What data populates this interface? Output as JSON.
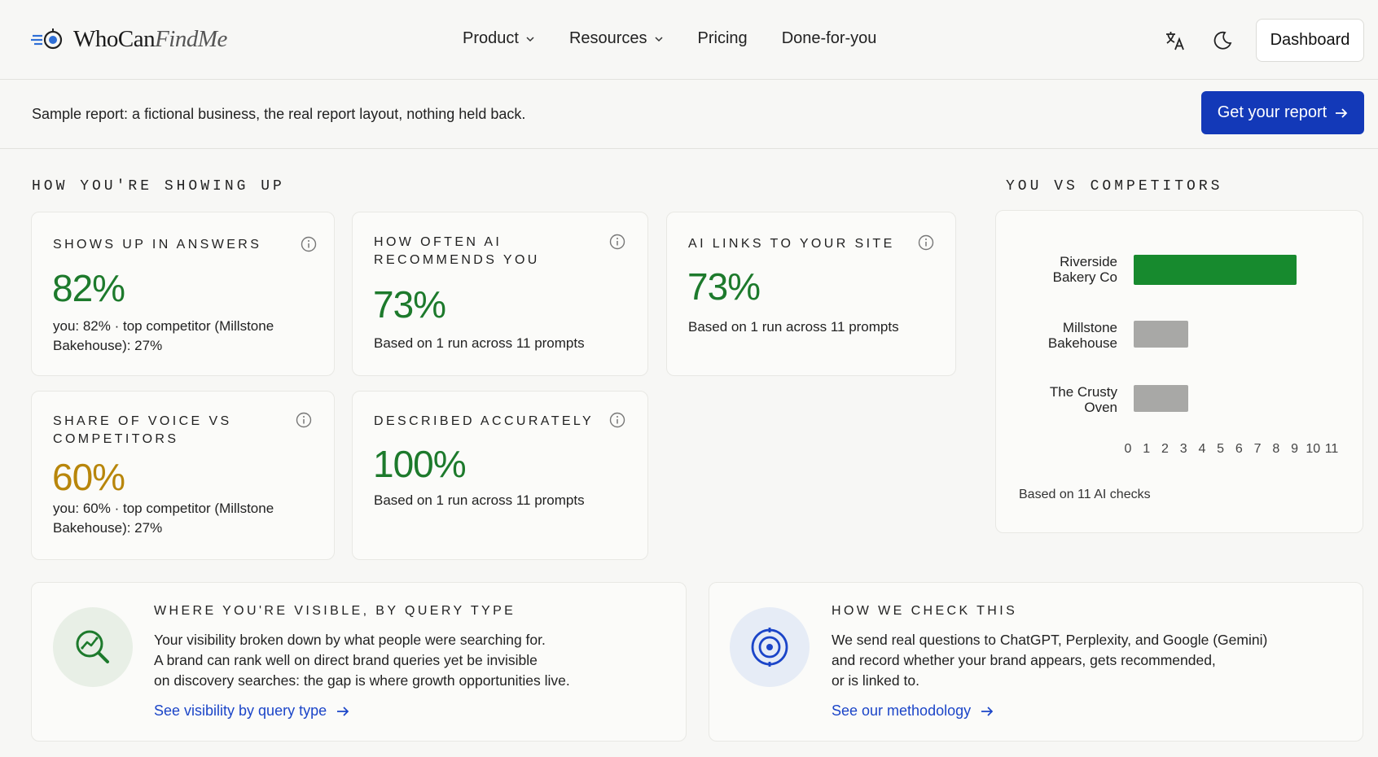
{
  "brand": {
    "name_main": "WhoCan",
    "name_italic": "FindMe",
    "logo_icon": "radar-logo-icon"
  },
  "nav": {
    "items": [
      {
        "label": "Product",
        "has_dropdown": true
      },
      {
        "label": "Resources",
        "has_dropdown": true
      },
      {
        "label": "Pricing",
        "has_dropdown": false
      },
      {
        "label": "Done-for-you",
        "has_dropdown": false
      }
    ],
    "dashboard_label": "Dashboard"
  },
  "banner": {
    "text": "Sample report: a fictional business, the real report layout, nothing held back.",
    "cta_label": "Get your report"
  },
  "showing_up": {
    "title": "HOW YOU'RE SHOWING UP",
    "cards": [
      {
        "label": "SHOWS UP IN ANSWERS",
        "value": "82%",
        "sub_1": "you: 82% · top competitor (Millstone",
        "sub_2": "Bakehouse): 27%"
      },
      {
        "label_1": "HOW OFTEN AI",
        "label_2": "RECOMMENDS YOU",
        "value": "73%",
        "sub": "Based on 1 run across 11 prompts"
      },
      {
        "label": "AI LINKS TO YOUR SITE",
        "value": "73%",
        "sub": "Based on 1 run across 11 prompts"
      },
      {
        "label_1": "SHARE OF VOICE VS",
        "label_2": "COMPETITORS",
        "value": "60%",
        "sub_1": "you: 60% · top competitor (Millstone",
        "sub_2": "Bakehouse): 27%"
      },
      {
        "label": "DESCRIBED ACCURATELY",
        "value": "100%",
        "sub": "Based on 1 run across 11 prompts"
      }
    ]
  },
  "competitors": {
    "title": "YOU VS COMPETITORS",
    "note": "Based on 11 AI checks"
  },
  "chart_data": {
    "type": "bar",
    "orientation": "horizontal",
    "categories": [
      "Riverside Bakery Co",
      "Millstone Bakehouse",
      "The Crusty Oven"
    ],
    "category_lines": [
      [
        "Riverside",
        "Bakery Co"
      ],
      [
        "Millstone",
        "Bakehouse"
      ],
      [
        "The Crusty",
        "Oven"
      ]
    ],
    "values": [
      9,
      3,
      3
    ],
    "colors": [
      "#178a2e",
      "#a8a8a6",
      "#a8a8a6"
    ],
    "xlim": [
      0,
      11
    ],
    "ticks": [
      "0",
      "1",
      "2",
      "3",
      "4",
      "5",
      "6",
      "7",
      "8",
      "9",
      "10",
      "11"
    ],
    "grid": false
  },
  "query_type": {
    "title": "WHERE YOU'RE VISIBLE, BY QUERY TYPE",
    "body_1": "Your visibility broken down by what people were searching for.",
    "body_2": "A brand can rank well on direct brand queries yet be invisible",
    "body_3": "on discovery searches: the gap is where growth opportunities live.",
    "link": "See visibility by query type",
    "icon": "search-trend-icon"
  },
  "methodology": {
    "title": "HOW WE CHECK THIS",
    "body_1": "We send real questions to ChatGPT, Perplexity, and Google (Gemini)",
    "body_2": "and record whether your brand appears, gets recommended,",
    "body_3": "or is linked to.",
    "link": "See our methodology",
    "icon": "target-icon"
  }
}
